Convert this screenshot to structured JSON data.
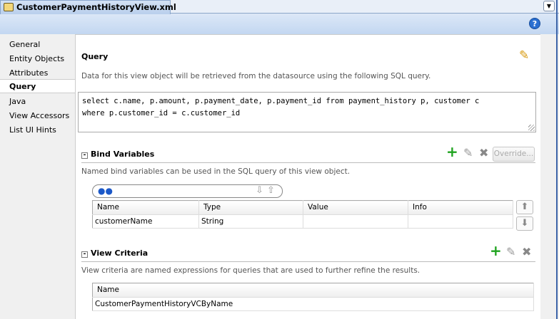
{
  "tab": {
    "title": "CustomerPaymentHistoryView.xml"
  },
  "nav": {
    "items": [
      {
        "label": "General"
      },
      {
        "label": "Entity Objects"
      },
      {
        "label": "Attributes"
      },
      {
        "label": "Query"
      },
      {
        "label": "Java"
      },
      {
        "label": "View Accessors"
      },
      {
        "label": "List UI Hints"
      }
    ],
    "selected": "Query"
  },
  "help": "?",
  "query": {
    "title": "Query",
    "description": "Data for this view object will be retrieved from the datasource using the following SQL query.",
    "sql_line1": "select c.name, p.amount, p.payment_date, p.payment_id from payment_history p, customer c",
    "sql_line2": "where p.customer_id = c.customer_id"
  },
  "bind": {
    "title": "Bind Variables",
    "description": "Named bind variables can be used in the SQL query of this view object.",
    "override": "Override...",
    "columns": [
      "Name",
      "Type",
      "Value",
      "Info"
    ],
    "rows": [
      [
        "customerName",
        "String",
        "",
        ""
      ]
    ]
  },
  "criteria": {
    "title": "View Criteria",
    "description": "View criteria are named expressions for queries that are used to further refine the results.",
    "column": "Name",
    "rows": [
      "CustomerPaymentHistoryVCByName"
    ]
  }
}
